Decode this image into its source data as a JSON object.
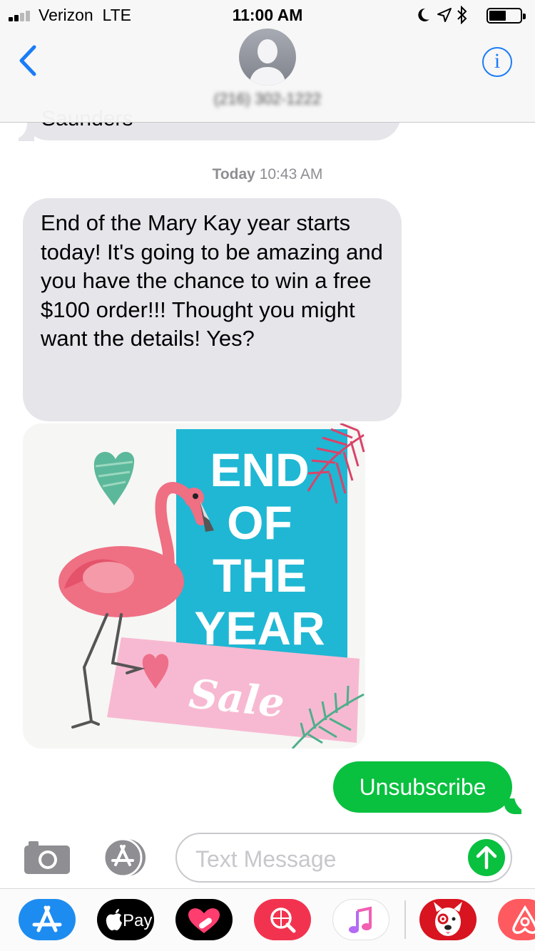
{
  "status_bar": {
    "carrier": "Verizon",
    "network": "LTE",
    "time": "11:00 AM",
    "signal_bars": 2,
    "signal_total": 4,
    "battery_level": 0.55
  },
  "header": {
    "back_icon": "chevron-left-icon",
    "contact_name": "(216) 302-1222",
    "info_icon": "info-circle-icon"
  },
  "conversation": {
    "previous_message_tail": "Saunders",
    "timestamp": {
      "day": "Today",
      "time": "10:43 AM"
    },
    "received_message": "End of the Mary Kay year starts today!  It's going to be amazing and you have the chance to win a free $100 order!!!  Thought you might want the details! Yes?",
    "image": {
      "line1": "END",
      "line2": "OF",
      "line3": "THE",
      "line4": "YEAR",
      "script": "Sale",
      "colors": {
        "panel": "#1fb7d4",
        "pink": "#f7b9d1",
        "flamingo": "#ef6f83",
        "heart_green": "#5cb89a"
      }
    },
    "sent_message": "Unsubscribe"
  },
  "composer": {
    "placeholder": "Text Message",
    "camera_icon": "camera-icon",
    "apps_icon": "app-store-icon",
    "send_icon": "arrow-up-icon"
  },
  "app_drawer": {
    "apple_pay_label": "Pay",
    "apps": [
      "app-store",
      "apple-pay",
      "digital-touch",
      "images-search",
      "music",
      "target",
      "airbnb"
    ]
  },
  "colors": {
    "accent_blue": "#1a7cf7",
    "sent_green": "#09c03f",
    "received_gray": "#e5e5ea"
  }
}
